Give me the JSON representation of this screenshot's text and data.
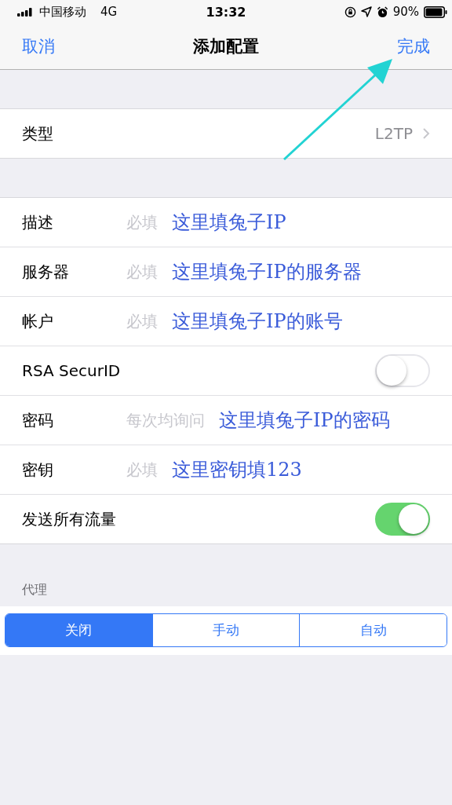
{
  "status_bar": {
    "carrier": "中国移动",
    "network": "4G",
    "time": "13:32",
    "battery": "90%"
  },
  "nav": {
    "cancel": "取消",
    "title": "添加配置",
    "done": "完成"
  },
  "type_row": {
    "label": "类型",
    "value": "L2TP"
  },
  "rows": [
    {
      "kind": "field",
      "label": "描述",
      "placeholder": "必填",
      "note": "这里填兔子IP"
    },
    {
      "kind": "field",
      "label": "服务器",
      "placeholder": "必填",
      "note": "这里填兔子IP的服务器"
    },
    {
      "kind": "field",
      "label": "帐户",
      "placeholder": "必填",
      "note": "这里填兔子IP的账号"
    },
    {
      "kind": "switch",
      "label": "RSA SecurID",
      "on": false
    },
    {
      "kind": "field",
      "label": "密码",
      "placeholder": "每次均询问",
      "note": "这里填兔子IP的密码"
    },
    {
      "kind": "field",
      "label": "密钥",
      "placeholder": "必填",
      "note": "这里密钥填123"
    },
    {
      "kind": "switch",
      "label": "发送所有流量",
      "on": true
    }
  ],
  "proxy": {
    "header": "代理",
    "segments": [
      {
        "label": "关闭",
        "selected": true
      },
      {
        "label": "手动",
        "selected": false
      },
      {
        "label": "自动",
        "selected": false
      }
    ]
  }
}
